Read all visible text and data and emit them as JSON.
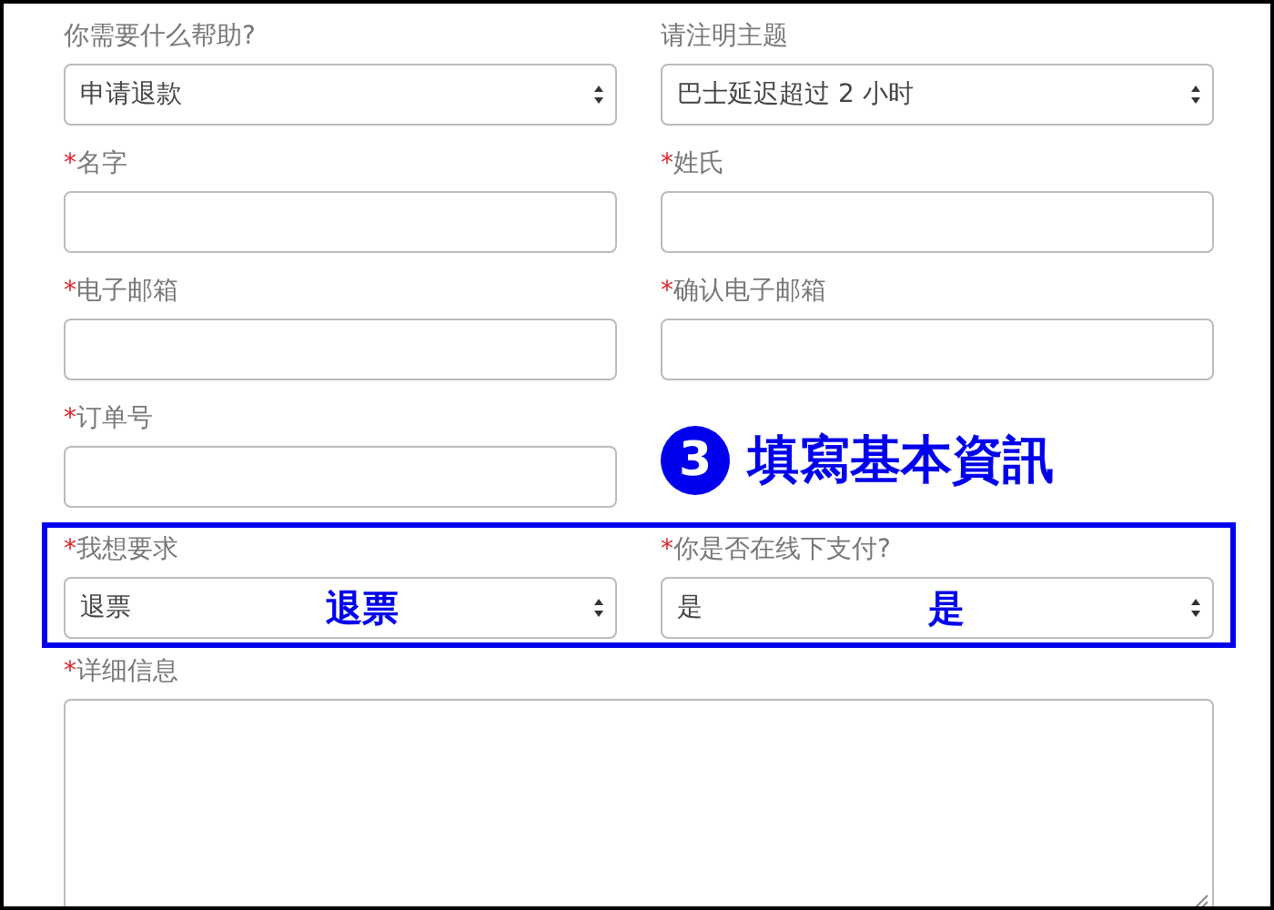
{
  "rows": [
    {
      "highlighted": false,
      "cells": [
        {
          "kind": "select",
          "label": "你需要什么帮助?",
          "value": "申请退款"
        },
        {
          "kind": "select",
          "label": "请注明主题",
          "value": "巴士延迟超过 2 小时"
        }
      ]
    },
    {
      "highlighted": false,
      "cells": [
        {
          "kind": "text",
          "label": "名字",
          "mark": "*"
        },
        {
          "kind": "text",
          "label": "姓氏",
          "mark": "*"
        }
      ]
    },
    {
      "highlighted": false,
      "cells": [
        {
          "kind": "text",
          "label": "电子邮箱",
          "mark": "*"
        },
        {
          "kind": "text",
          "label": "确认电子邮箱",
          "mark": "*"
        }
      ]
    },
    {
      "highlighted": false,
      "cells": [
        {
          "kind": "text",
          "label": "订单号",
          "mark": "*"
        },
        {
          "kind": "step",
          "number": "3",
          "text": "填寫基本資訊"
        }
      ]
    },
    {
      "highlighted": true,
      "cells": [
        {
          "kind": "select",
          "label": "我想要求",
          "mark": "*",
          "value": "退票",
          "annotation": "退票"
        },
        {
          "kind": "select",
          "label": "你是否在线下支付?",
          "mark": "*",
          "value": "是",
          "annotation": "是"
        }
      ]
    },
    {
      "highlighted": false,
      "cells": [
        {
          "kind": "textarea",
          "label": "详细信息",
          "mark": "*"
        }
      ]
    }
  ]
}
